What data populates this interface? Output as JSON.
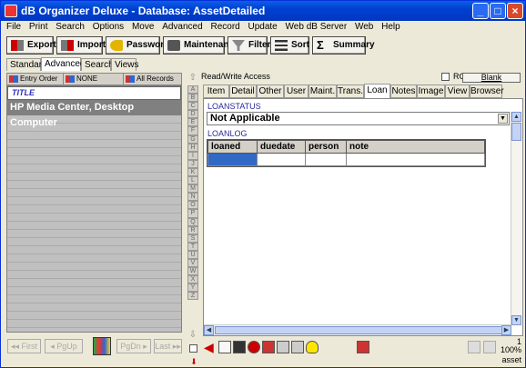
{
  "window": {
    "title": "dB Organizer Deluxe - Database: AssetDetailed"
  },
  "menu": [
    "File",
    "Print",
    "Search",
    "Options",
    "Move",
    "Advanced",
    "Record",
    "Update",
    "Web dB Server",
    "Web",
    "Help"
  ],
  "toolbar": {
    "export": "Export",
    "import": "Import",
    "password": "Password",
    "maintenance": "Maintenance",
    "filter": "Filter",
    "sort": "Sort",
    "summary": "Summary"
  },
  "left_tabs": [
    "Standard",
    "Advanced",
    "Search",
    "Views"
  ],
  "left_header": {
    "order": "Entry Order",
    "filter": "NONE",
    "records": "All Records"
  },
  "list": {
    "title": "TITLE",
    "selected": "HP Media Center, Desktop Computer"
  },
  "left_nav": {
    "first": "First",
    "pgup": "PgUp",
    "pgdn": "PgDn",
    "last": "Last"
  },
  "alpha": [
    "A",
    "B",
    "C",
    "D",
    "E",
    "F",
    "G",
    "H",
    "I",
    "J",
    "K",
    "L",
    "M",
    "N",
    "O",
    "P",
    "Q",
    "R",
    "S",
    "T",
    "U",
    "V",
    "W",
    "X",
    "Y",
    "Z"
  ],
  "access": {
    "label": "Read/Write Access",
    "ro": "RO",
    "blank": "Blank"
  },
  "tabs": [
    "Item",
    "Detail",
    "Other",
    "User",
    "Maint.",
    "Trans.",
    "Loan",
    "Notes",
    "Image",
    "View",
    "Browser"
  ],
  "active_tab": "Loan",
  "loan": {
    "status_label": "LOANSTATUS",
    "status_value": "Not Applicable",
    "log_label": "LOANLOG",
    "columns": [
      "loaned",
      "duedate",
      "person",
      "note"
    ]
  },
  "status": {
    "page": "1",
    "zoom": "100%",
    "user": "asset"
  }
}
